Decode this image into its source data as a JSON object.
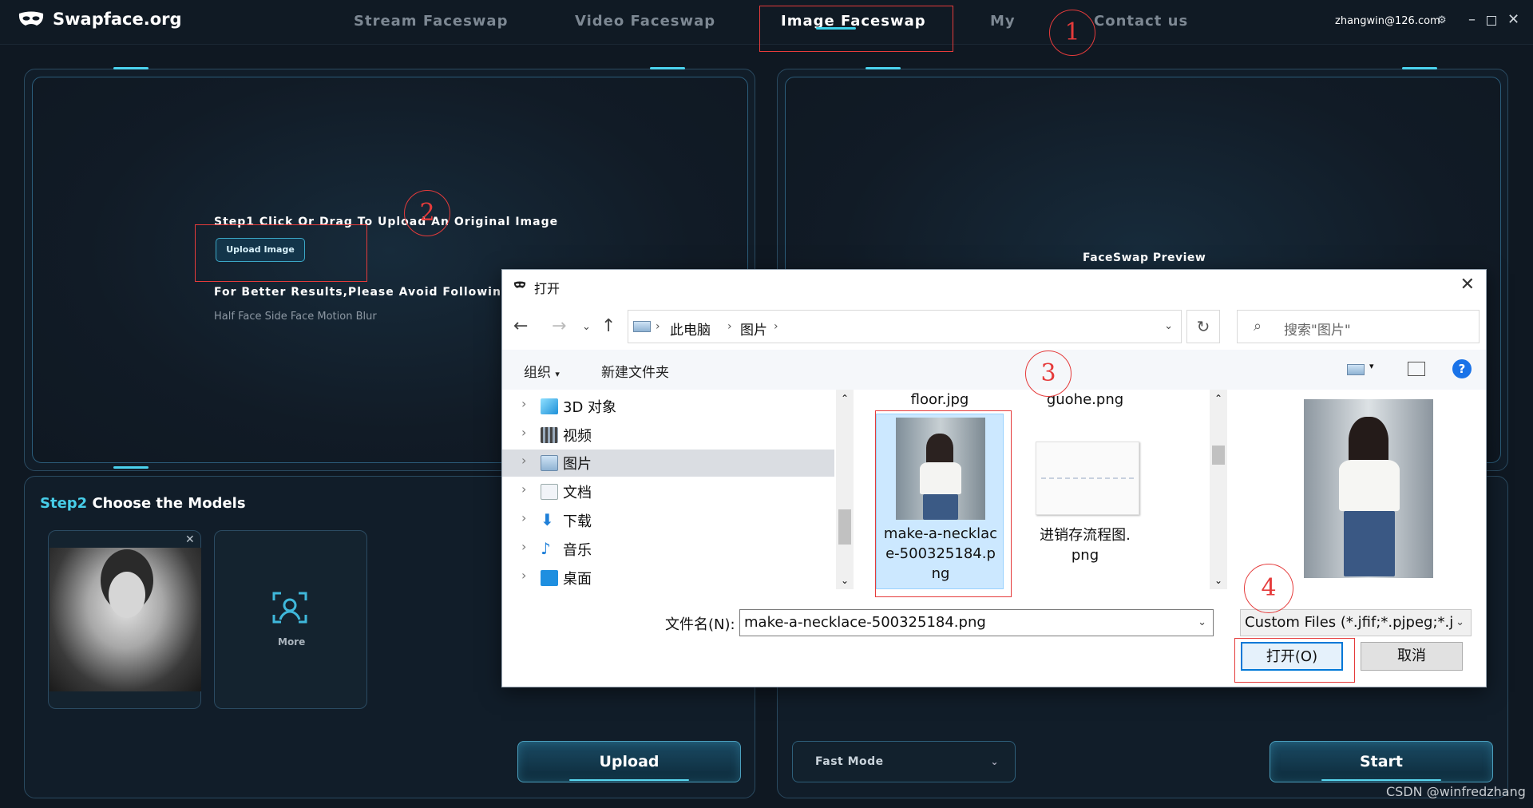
{
  "app": {
    "logo_text": "Swapface.org",
    "nav": [
      "Stream Faceswap",
      "Video Faceswap",
      "Image Faceswap",
      "My",
      "Contact us"
    ],
    "active_nav": "Image Faceswap",
    "user_email": "zhangwin@126.com",
    "accent_color": "#47cde8"
  },
  "left_panel": {
    "step1": "Step1 Click Or Drag To Upload An Original Image",
    "upload_image_button": "Upload Image",
    "better_results": "For Better Results,Please Avoid Following Ca",
    "avoid_list": "Half Face Side Face Motion Blur"
  },
  "right_panel": {
    "preview_label": "FaceSwap Preview"
  },
  "step2": {
    "prefix": "Step2",
    "title": "Choose the Models",
    "more_label": "More"
  },
  "bottom": {
    "upload_button": "Upload",
    "mode_select": "Fast Mode",
    "start_button": "Start"
  },
  "dialog": {
    "title": "打开",
    "breadcrumb": [
      "此电脑",
      "图片"
    ],
    "search_placeholder": "搜索\"图片\"",
    "toolbar": {
      "organize": "组织",
      "new_folder": "新建文件夹"
    },
    "tree": [
      "3D 对象",
      "视频",
      "图片",
      "文档",
      "下载",
      "音乐",
      "桌面"
    ],
    "selected_tree": "图片",
    "files_top": [
      "floor.jpg",
      "guohe.png"
    ],
    "file_selected_name": "make-a-necklace-500325184.png",
    "file_selected_lines": [
      "make-a-necklac",
      "e-500325184.p",
      "ng"
    ],
    "file_other_lines": [
      "进销存流程图.",
      "png"
    ],
    "filename_label": "文件名(N):",
    "filename_value": "make-a-necklace-500325184.png",
    "filter_value": "Custom Files (*.jfif;*.pjpeg;*.jp",
    "open_button": "打开(O)",
    "cancel_button": "取消"
  },
  "annotations": [
    "1",
    "2",
    "3",
    "4"
  ],
  "watermark": "CSDN @winfredzhang"
}
